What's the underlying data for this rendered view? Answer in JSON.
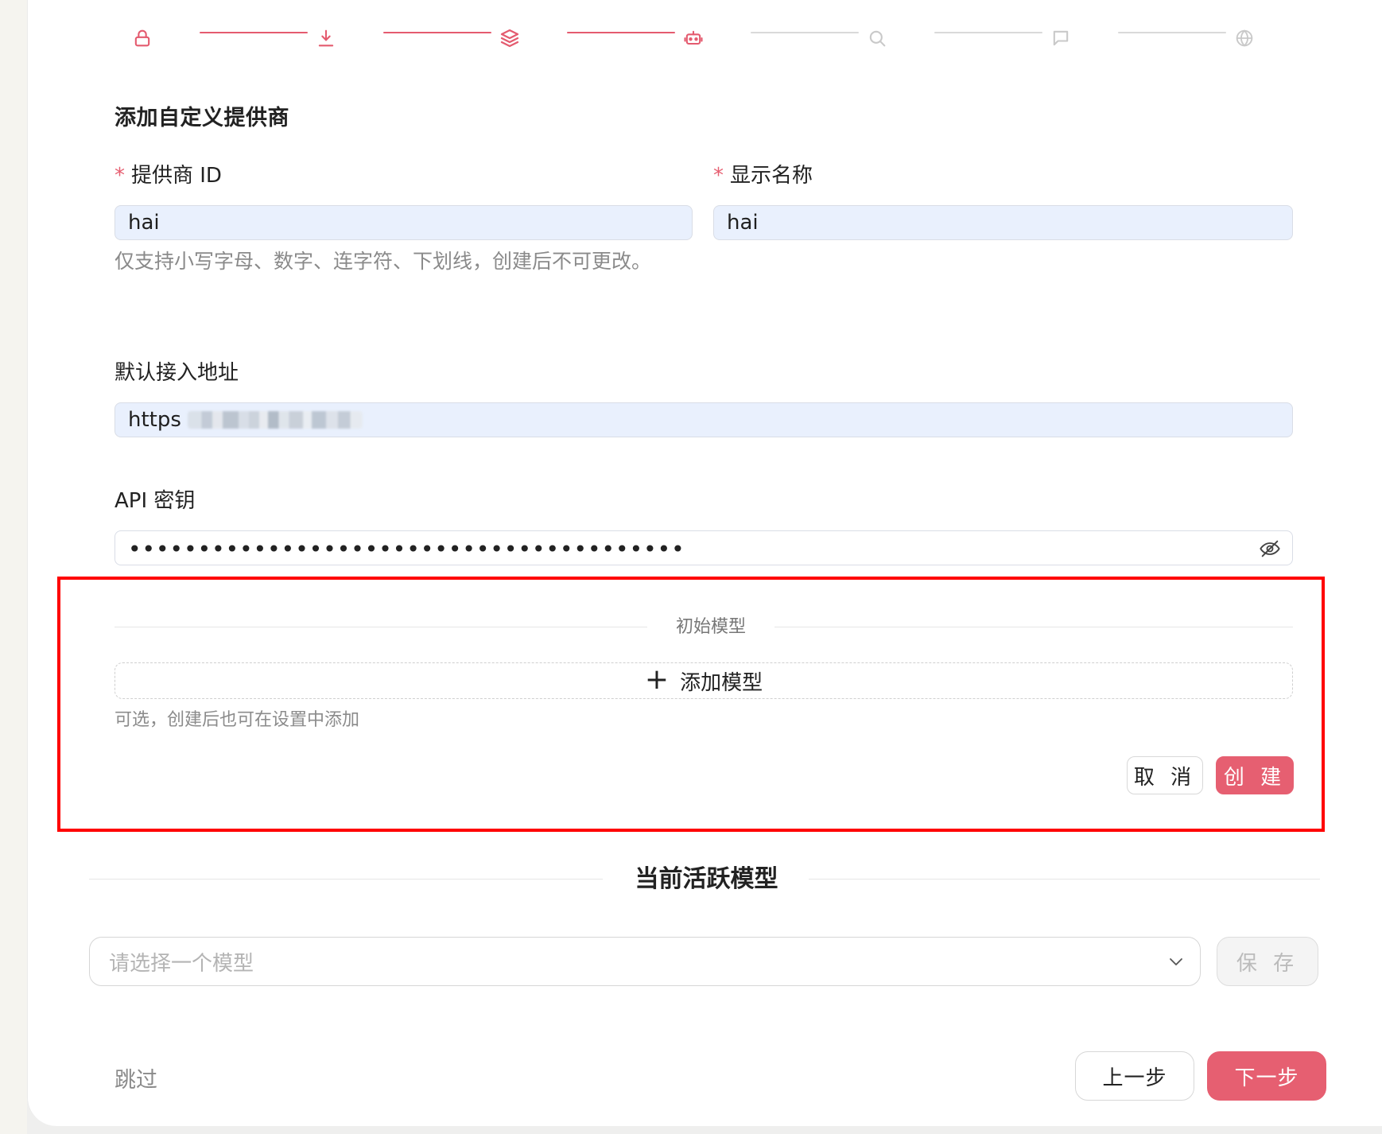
{
  "stepper": {
    "icons": [
      {
        "name": "lock-icon",
        "active": true
      },
      {
        "name": "download-icon",
        "active": true
      },
      {
        "name": "layers-icon",
        "active": true
      },
      {
        "name": "robot-icon",
        "active": true
      },
      {
        "name": "search-icon",
        "active": false
      },
      {
        "name": "chat-icon",
        "active": false
      },
      {
        "name": "globe-icon",
        "active": false
      }
    ],
    "active_color": "#e45b6f",
    "inactive_color": "#c9c9c9"
  },
  "form": {
    "title": "添加自定义提供商",
    "provider_id": {
      "required_mark": "*",
      "label": "提供商 ID",
      "value": "hai",
      "hint": "仅支持小写字母、数字、连字符、下划线，创建后不可更改。"
    },
    "display_name": {
      "required_mark": "*",
      "label": "显示名称",
      "value": "hai"
    },
    "base_url": {
      "label": "默认接入地址",
      "value_prefix": "https"
    },
    "api_key": {
      "label": "API 密钥",
      "masked_value": "••••••••••••••••••••••••••••••••••••••••",
      "visibility_icon": "eye-off-icon"
    },
    "initial_model": {
      "divider_label": "初始模型",
      "add_button": "添加模型",
      "hint": "可选，创建后也可在设置中添加"
    },
    "actions": {
      "cancel": "取 消",
      "create": "创 建"
    }
  },
  "active_model": {
    "title": "当前活跃模型",
    "select_placeholder": "请选择一个模型",
    "save": "保 存"
  },
  "footer": {
    "skip": "跳过",
    "prev": "上一步",
    "next": "下一步"
  },
  "colors": {
    "accent": "#e65f71",
    "input_fill": "#e9f0fd",
    "highlight": "#ff0000"
  }
}
